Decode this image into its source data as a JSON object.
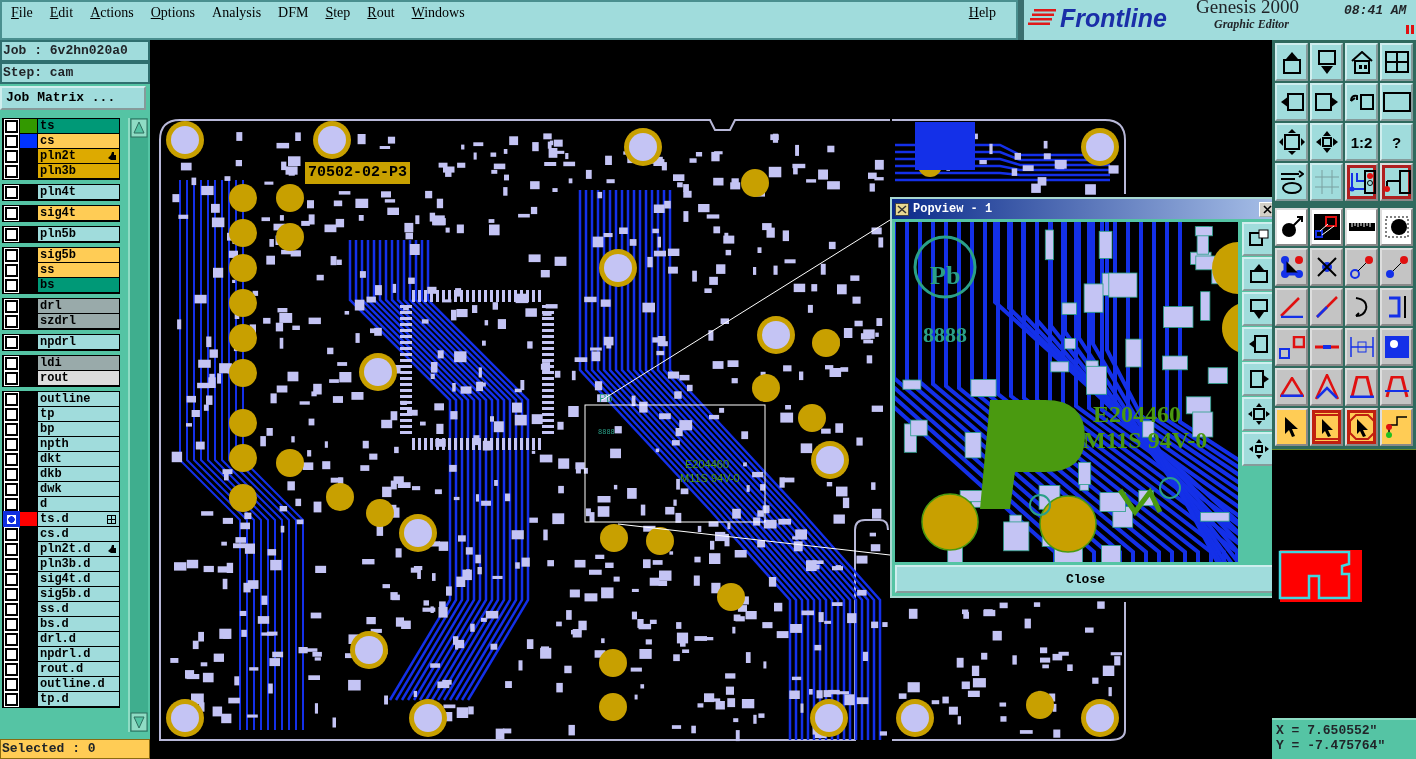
{
  "menu": [
    {
      "label": "File",
      "mnemonic": true
    },
    {
      "label": "Edit",
      "mnemonic": true
    },
    {
      "label": "Actions",
      "mnemonic": true
    },
    {
      "label": "Options",
      "mnemonic": true
    },
    {
      "label": "Analysis",
      "mnemonic": false
    },
    {
      "label": "DFM",
      "mnemonic": false
    },
    {
      "label": "Step",
      "mnemonic": true
    },
    {
      "label": "Rout",
      "mnemonic": true
    },
    {
      "label": "Windows",
      "mnemonic": true
    }
  ],
  "help": {
    "label": "Help"
  },
  "brand": {
    "logo": "Frontline",
    "product": "Genesis 2000",
    "subtitle": "Graphic Editor",
    "time": "08:41 AM"
  },
  "job": "Job : 6v2hn020a0",
  "step": "Step: cam",
  "job_matrix_button": "Job Matrix ...",
  "layer_groups": [
    {
      "layers": [
        {
          "name": "ts",
          "color": "#009977",
          "swatch": {
            "color": "#339900"
          },
          "selected": false,
          "hand": false,
          "grid": false
        },
        {
          "name": "cs",
          "color": "#ffcc55",
          "swatch": {
            "color": "#0033ff"
          },
          "selected": false,
          "hand": false,
          "grid": false
        },
        {
          "name": "pln2t",
          "color": "#ddaa00",
          "selected": false,
          "hand": true,
          "grid": false
        },
        {
          "name": "pln3b",
          "color": "#ddaa00",
          "selected": false,
          "hand": false,
          "grid": false
        }
      ]
    },
    {
      "layers": [
        {
          "name": "pln4t",
          "color": "#a0dcdc",
          "selected": false,
          "hand": false,
          "grid": false
        }
      ]
    },
    {
      "layers": [
        {
          "name": "sig4t",
          "color": "#ffcc55",
          "selected": false,
          "hand": false,
          "grid": false
        }
      ]
    },
    {
      "layers": [
        {
          "name": "pln5b",
          "color": "#a0dcdc",
          "selected": false,
          "hand": false,
          "grid": false
        }
      ]
    },
    {
      "layers": [
        {
          "name": "sig5b",
          "color": "#ffcc55",
          "selected": false,
          "hand": false,
          "grid": false
        },
        {
          "name": "ss",
          "color": "#ffcc55",
          "selected": false,
          "hand": false,
          "grid": false
        },
        {
          "name": "bs",
          "color": "#009977",
          "selected": false,
          "hand": false,
          "grid": false
        }
      ]
    },
    {
      "layers": [
        {
          "name": "drl",
          "color": "#99aaaa",
          "selected": false,
          "hand": false,
          "grid": false
        },
        {
          "name": "szdrl",
          "color": "#99aaaa",
          "selected": false,
          "hand": false,
          "grid": false
        }
      ]
    },
    {
      "layers": [
        {
          "name": "npdrl",
          "color": "#a0dcdc",
          "selected": false,
          "hand": false,
          "grid": false
        }
      ]
    },
    {
      "layers": [
        {
          "name": "ldi",
          "color": "#99aaaa",
          "selected": false,
          "hand": false,
          "grid": false
        },
        {
          "name": "rout",
          "color": "#dddddd",
          "selected": false,
          "hand": false,
          "grid": false
        }
      ]
    },
    {
      "layers": [
        {
          "name": "outline",
          "color": "#a0dcdc",
          "selected": false,
          "hand": false,
          "grid": false
        },
        {
          "name": "tp",
          "color": "#a0dcdc",
          "selected": false,
          "hand": false,
          "grid": false
        },
        {
          "name": "bp",
          "color": "#a0dcdc",
          "selected": false,
          "hand": false,
          "grid": false
        },
        {
          "name": "npth",
          "color": "#a0dcdc",
          "selected": false,
          "hand": false,
          "grid": false
        },
        {
          "name": "dkt",
          "color": "#a0dcdc",
          "selected": false,
          "hand": false,
          "grid": false
        },
        {
          "name": "dkb",
          "color": "#a0dcdc",
          "selected": false,
          "hand": false,
          "grid": false
        },
        {
          "name": "dwk",
          "color": "#a0dcdc",
          "selected": false,
          "hand": false,
          "grid": false
        },
        {
          "name": "d",
          "color": "#a0dcdc",
          "selected": false,
          "hand": false,
          "grid": false
        },
        {
          "name": "ts.d",
          "color": "#a0dcdc",
          "swatch": {
            "color": "#ff0000"
          },
          "selected": true,
          "hand": false,
          "grid": true
        },
        {
          "name": "cs.d",
          "color": "#a0dcdc",
          "selected": false,
          "hand": false,
          "grid": false
        },
        {
          "name": "pln2t.d",
          "color": "#a0dcdc",
          "selected": false,
          "hand": true,
          "grid": false
        },
        {
          "name": "pln3b.d",
          "color": "#a0dcdc",
          "selected": false,
          "hand": false,
          "grid": false
        },
        {
          "name": "sig4t.d",
          "color": "#a0dcdc",
          "selected": false,
          "hand": false,
          "grid": false
        },
        {
          "name": "sig5b.d",
          "color": "#a0dcdc",
          "selected": false,
          "hand": false,
          "grid": false
        },
        {
          "name": "ss.d",
          "color": "#a0dcdc",
          "selected": false,
          "hand": false,
          "grid": false
        },
        {
          "name": "bs.d",
          "color": "#a0dcdc",
          "selected": false,
          "hand": false,
          "grid": false
        },
        {
          "name": "drl.d",
          "color": "#a0dcdc",
          "selected": false,
          "hand": false,
          "grid": false
        },
        {
          "name": "npdrl.d",
          "color": "#a0dcdc",
          "selected": false,
          "hand": false,
          "grid": false
        },
        {
          "name": "rout.d",
          "color": "#a0dcdc",
          "selected": false,
          "hand": false,
          "grid": false
        },
        {
          "name": "outline.d",
          "color": "#a0dcdc",
          "selected": false,
          "hand": false,
          "grid": false
        },
        {
          "name": "tp.d",
          "color": "#a0dcdc",
          "selected": false,
          "hand": false,
          "grid": false
        }
      ]
    }
  ],
  "selected_count": "Selected : 0",
  "canvas": {
    "markings": [
      {
        "text": "70502-02-P3",
        "kind": "label"
      },
      {
        "text": "Pb",
        "kind": "small"
      },
      {
        "text": "8888",
        "kind": "small"
      },
      {
        "text": "E204460",
        "kind": "small"
      },
      {
        "text": "M11S 94V-0",
        "kind": "small"
      }
    ]
  },
  "popview": {
    "title": "Popview - 1",
    "markings": [
      {
        "text": "Pb"
      },
      {
        "text": "8888"
      },
      {
        "text": "E204460"
      },
      {
        "text": "M11S 94V-0"
      }
    ],
    "close_button": "Close"
  },
  "toolbar": [
    {
      "kind": "tool"
    },
    {
      "kind": "tool"
    },
    {
      "kind": "tool"
    },
    {
      "kind": "tool"
    },
    {
      "kind": "tool"
    },
    {
      "kind": "tool"
    },
    {
      "kind": "tool"
    },
    {
      "kind": "tool"
    },
    {
      "kind": "tool"
    },
    {
      "kind": "tool"
    },
    {
      "kind": "tool",
      "label": "1:2"
    },
    {
      "kind": "tool",
      "label": "?"
    },
    {
      "kind": "tool"
    },
    {
      "kind": "tool"
    },
    {
      "kind": "tool-active"
    },
    {
      "kind": "tool-active"
    },
    {
      "kind": "mode-white"
    },
    {
      "kind": "mode-white"
    },
    {
      "kind": "mode-white"
    },
    {
      "kind": "mode-white"
    },
    {
      "kind": "mode"
    },
    {
      "kind": "mode"
    },
    {
      "kind": "mode"
    },
    {
      "kind": "mode"
    },
    {
      "kind": "mode"
    },
    {
      "kind": "mode"
    },
    {
      "kind": "mode"
    },
    {
      "kind": "mode"
    },
    {
      "kind": "mode"
    },
    {
      "kind": "mode"
    },
    {
      "kind": "mode"
    },
    {
      "kind": "mode"
    },
    {
      "kind": "mode"
    },
    {
      "kind": "mode"
    },
    {
      "kind": "mode"
    },
    {
      "kind": "mode"
    },
    {
      "kind": "select"
    },
    {
      "kind": "select-active"
    },
    {
      "kind": "select-active"
    },
    {
      "kind": "select"
    }
  ],
  "coordinates": {
    "x": "X = 7.650552\"",
    "y": "Y = -7.475764\""
  }
}
